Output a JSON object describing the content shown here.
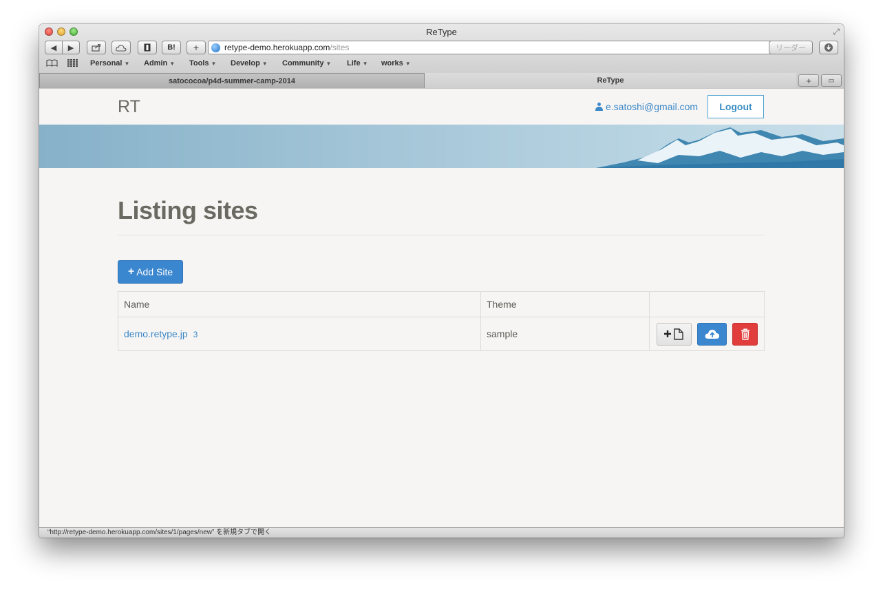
{
  "window": {
    "title": "ReType"
  },
  "toolbar": {
    "back_label": "◀",
    "forward_label": "▶",
    "hatena_label": "B!",
    "add_label": "+",
    "url_host": "retype-demo.herokuapp.com",
    "url_path": "/sites",
    "reader_label": "リーダー"
  },
  "bookmarks": [
    {
      "label": "Personal"
    },
    {
      "label": "Admin"
    },
    {
      "label": "Tools"
    },
    {
      "label": "Develop"
    },
    {
      "label": "Community"
    },
    {
      "label": "Life"
    },
    {
      "label": "works"
    }
  ],
  "tabs": [
    {
      "label": "satococoa/p4d-summer-camp-2014"
    },
    {
      "label": "ReType"
    }
  ],
  "navbar": {
    "brand": "RT",
    "user_email": "e.satoshi@gmail.com",
    "logout_label": "Logout"
  },
  "main": {
    "heading": "Listing sites",
    "add_button_label": "Add Site",
    "table": {
      "columns": [
        "Name",
        "Theme",
        ""
      ],
      "rows": [
        {
          "name": "demo.retype.jp",
          "count": "3",
          "theme": "sample"
        }
      ]
    }
  },
  "status": {
    "text": "“http://retype-demo.herokuapp.com/sites/1/pages/new” を新規タブで開く"
  },
  "colors": {
    "primary": "#3a86cf",
    "danger": "#e23d3d",
    "link": "#3b87c8",
    "heading": "#6b6a62"
  }
}
